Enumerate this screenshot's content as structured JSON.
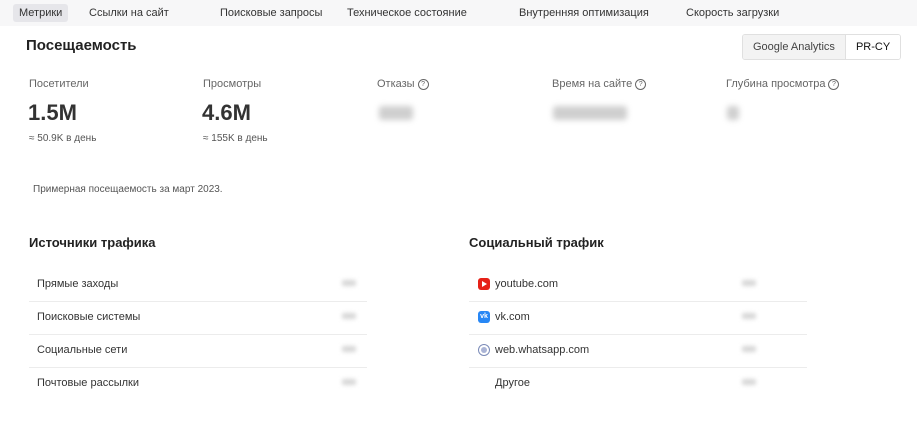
{
  "nav": {
    "tabs": [
      {
        "label": "Метрики"
      },
      {
        "label": "Ссылки на сайт"
      },
      {
        "label": "Поисковые запросы"
      },
      {
        "label": "Техническое состояние"
      },
      {
        "label": "Внутренняя оптимизация"
      },
      {
        "label": "Скорость загрузки"
      }
    ],
    "active": "Метрики"
  },
  "header": {
    "title": "Посещаемость",
    "sources": [
      "Google Analytics",
      "PR-CY"
    ],
    "selected_source": "PR-CY"
  },
  "metrics": [
    {
      "label": "Посетители",
      "value": "1.5M",
      "sub": "≈ 50.9K в день"
    },
    {
      "label": "Просмотры",
      "value": "4.6M",
      "sub": "≈ 155K в день"
    },
    {
      "label": "Отказы",
      "help_icon": "question-icon"
    },
    {
      "label": "Время на сайте",
      "help_icon": "question-icon"
    },
    {
      "label": "Глубина просмотра",
      "help_icon": "question-icon"
    }
  ],
  "note": "Примерная посещаемость за март 2023.",
  "traffic_sources": {
    "title": "Источники трафика",
    "rows": [
      {
        "label": "Прямые заходы"
      },
      {
        "label": "Поисковые системы"
      },
      {
        "label": "Социальные сети"
      },
      {
        "label": "Почтовые рассылки"
      }
    ]
  },
  "social_traffic": {
    "title": "Социальный трафик",
    "rows": [
      {
        "label": "youtube.com",
        "icon": "youtube-icon"
      },
      {
        "label": "vk.com",
        "icon": "vk-icon"
      },
      {
        "label": "web.whatsapp.com",
        "icon": "globe-icon"
      },
      {
        "label": "Другое",
        "icon": ""
      }
    ]
  },
  "colors": {
    "youtube": "#e62117",
    "vk": "#2787f5",
    "nav_bg": "#f7f7f8"
  }
}
